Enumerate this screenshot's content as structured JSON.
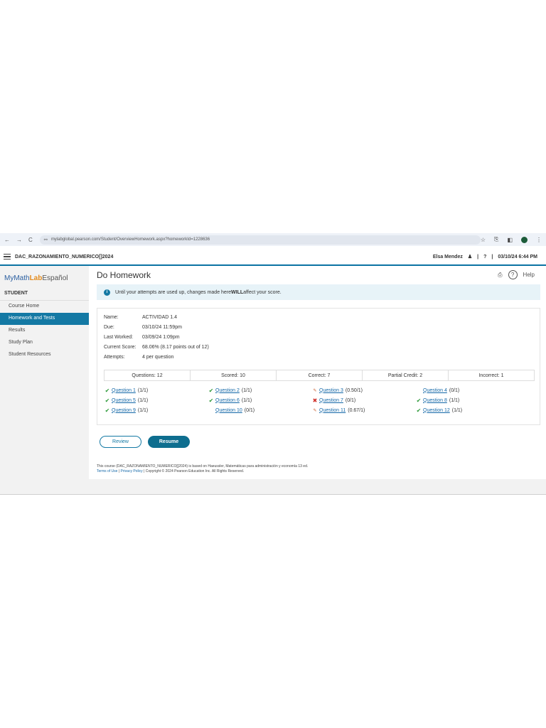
{
  "browser": {
    "url": "mylabglobal.pearson.com/Student/OverviewHomework.aspx?homeworkId=1228636",
    "nav": {
      "back": "←",
      "forward": "→",
      "reload": "C"
    },
    "icons": [
      "star-icon",
      "download-icon",
      "sidepanel-icon",
      "profile-icon",
      "more-icon"
    ]
  },
  "header": {
    "course": "DAC_RAZONAMIENTO_NUMERICO[]2024",
    "user": "Elsa Mendez",
    "datetime": "03/10/24 6:44 PM",
    "sep": "|",
    "user_icon": "♟",
    "help_icon": "?"
  },
  "sidebar": {
    "logo": {
      "my": "My",
      "math": "Math",
      "lab": "Lab",
      "es": "Español"
    },
    "section": "STUDENT",
    "items": [
      {
        "label": "Course Home",
        "active": false
      },
      {
        "label": "Homework and Tests",
        "active": true
      },
      {
        "label": "Results",
        "active": false
      },
      {
        "label": "Study Plan",
        "active": false
      },
      {
        "label": "Student Resources",
        "active": false
      }
    ]
  },
  "main": {
    "title": "Do Homework",
    "help": "Help",
    "notice": {
      "pre": "Until your attempts are used up, changes made here ",
      "bold": "WILL",
      "post": " affect your score."
    },
    "info": [
      {
        "label": "Name:",
        "value": "ACTIVIDAD 1.4"
      },
      {
        "label": "Due:",
        "value": "03/10/24 11:59pm"
      },
      {
        "label": "Last Worked:",
        "value": "03/09/24 1:09pm"
      },
      {
        "label": "Current Score:",
        "value": "68.06% (8.17 points out of 12)"
      },
      {
        "label": "Attempts:",
        "value": "4 per question"
      }
    ],
    "stats": [
      "Questions: 12",
      "Scored: 10",
      "Correct: 7",
      "Partial Credit: 2",
      "Incorrect: 1"
    ],
    "questions": [
      [
        {
          "name": "Question 1",
          "score": "(1/1)",
          "status": "correct"
        },
        {
          "name": "Question 2",
          "score": "(1/1)",
          "status": "correct"
        },
        {
          "name": "Question 3",
          "score": "(0.50/1)",
          "status": "partial"
        },
        {
          "name": "Question 4",
          "score": "(0/1)",
          "status": "none"
        }
      ],
      [
        {
          "name": "Question 5",
          "score": "(1/1)",
          "status": "correct"
        },
        {
          "name": "Question 6",
          "score": "(1/1)",
          "status": "correct"
        },
        {
          "name": "Question 7",
          "score": "(0/1)",
          "status": "incorrect"
        },
        {
          "name": "Question 8",
          "score": "(1/1)",
          "status": "correct"
        }
      ],
      [
        {
          "name": "Question 9",
          "score": "(1/1)",
          "status": "correct"
        },
        {
          "name": "Question 10",
          "score": "(0/1)",
          "status": "none"
        },
        {
          "name": "Question 11",
          "score": "(0.67/1)",
          "status": "partial"
        },
        {
          "name": "Question 12",
          "score": "(1/1)",
          "status": "correct"
        }
      ]
    ],
    "buttons": {
      "review": "Review",
      "resume": "Resume"
    },
    "footer": {
      "line1": "This course (DAC_RAZONAMIENTO_NUMERICO[]2024) is based on Haeussler, Matemáticas para administración y economía 13 ed.",
      "terms": "Terms of Use",
      "privacy": "Privacy Policy",
      "copyright": "| Copyright © 2024 Pearson Education Inc. All Rights Reserved."
    }
  },
  "colors": {
    "accent": "#1479a4",
    "correct": "#2f9a3a",
    "incorrect": "#d0302a",
    "partial": "#c96030"
  }
}
